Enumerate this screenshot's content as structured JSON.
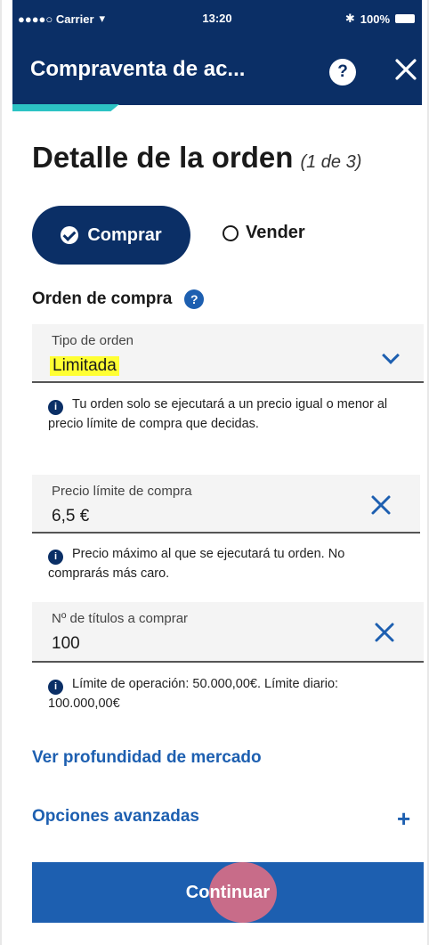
{
  "status_bar": {
    "carrier": "●●●●○ Carrier",
    "time": "13:20",
    "battery": "100%"
  },
  "header": {
    "title": "Compraventa de ac...",
    "help": "?"
  },
  "page": {
    "title": "Detalle de la orden",
    "step": "(1 de 3)"
  },
  "toggle": {
    "buy": "Comprar",
    "sell": "Vender"
  },
  "section": {
    "label": "Orden de compra",
    "help": "?"
  },
  "order_type": {
    "label": "Tipo de orden",
    "value": "Limitada",
    "hint": "Tu orden solo se ejecutará a un precio igual o menor al precio límite de compra que decidas."
  },
  "limit_price": {
    "label": "Precio límite de compra",
    "value": "6,5 €",
    "hint": "Precio máximo al que se ejecutará tu orden. No comprarás más caro."
  },
  "quantity": {
    "label": "Nº de títulos a comprar",
    "value": "100",
    "hint": "Límite de operación: 50.000,00€. Límite diario: 100.000,00€"
  },
  "links": {
    "market_depth": "Ver profundidad de mercado",
    "advanced": "Opciones avanzadas",
    "advanced_icon": "+"
  },
  "actions": {
    "continue": "Continuar"
  },
  "colors": {
    "navy": "#0b2f66",
    "blue": "#1d5fb0",
    "teal": "#2cc3c4",
    "highlight": "#ffff33"
  }
}
